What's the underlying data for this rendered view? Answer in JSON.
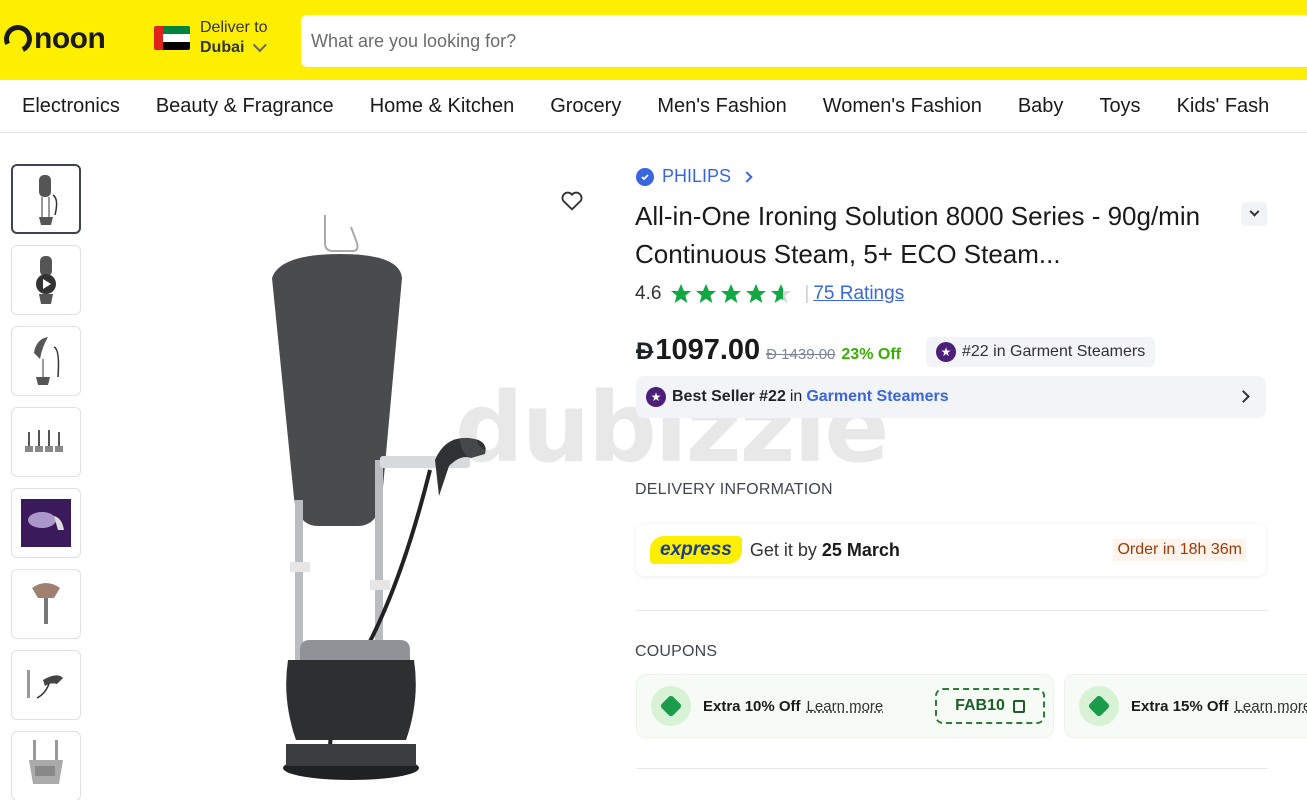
{
  "header": {
    "logo_text": "noon",
    "deliver_label": "Deliver to",
    "deliver_city": "Dubai",
    "search_placeholder": "What are you looking for?",
    "brand_color": "#feee00"
  },
  "nav": {
    "items": [
      "Electronics",
      "Beauty & Fragrance",
      "Home & Kitchen",
      "Grocery",
      "Men's Fashion",
      "Women's Fashion",
      "Baby",
      "Toys",
      "Kids' Fash"
    ]
  },
  "gallery": {
    "thumbnails": [
      "steamer-front",
      "video",
      "steamer-board",
      "attachments",
      "steam-purple",
      "steamer-head",
      "steamer-handheld",
      "steamer-base"
    ],
    "watermark": "dubizzle"
  },
  "product": {
    "brand": "PHILIPS",
    "title": "All-in-One Ironing Solution 8000 Series - 90g/min Continuous Steam, 5+ ECO Steam...",
    "rating": "4.6",
    "rating_value": 4.6,
    "ratings_link": "75 Ratings",
    "currency_symbol": "Đ",
    "price": "1097.00",
    "old_price": "Đ 1439.00",
    "discount": "23% Off",
    "rank_badge": "#22 in Garment Steamers",
    "bestseller_label": "Best Seller #22",
    "bestseller_in": "in",
    "bestseller_category": "Garment Steamers"
  },
  "delivery": {
    "section_title": "DELIVERY INFORMATION",
    "express_label": "express",
    "get_it_by": "Get it by",
    "date": "25 March",
    "order_in": "Order in 18h 36m"
  },
  "coupons": {
    "section_title": "COUPONS",
    "items": [
      {
        "text": "Extra 10% Off",
        "learn": "Learn more",
        "code": "FAB10"
      },
      {
        "text": "Extra 15% Off",
        "learn": "Learn more",
        "code": ""
      }
    ]
  }
}
